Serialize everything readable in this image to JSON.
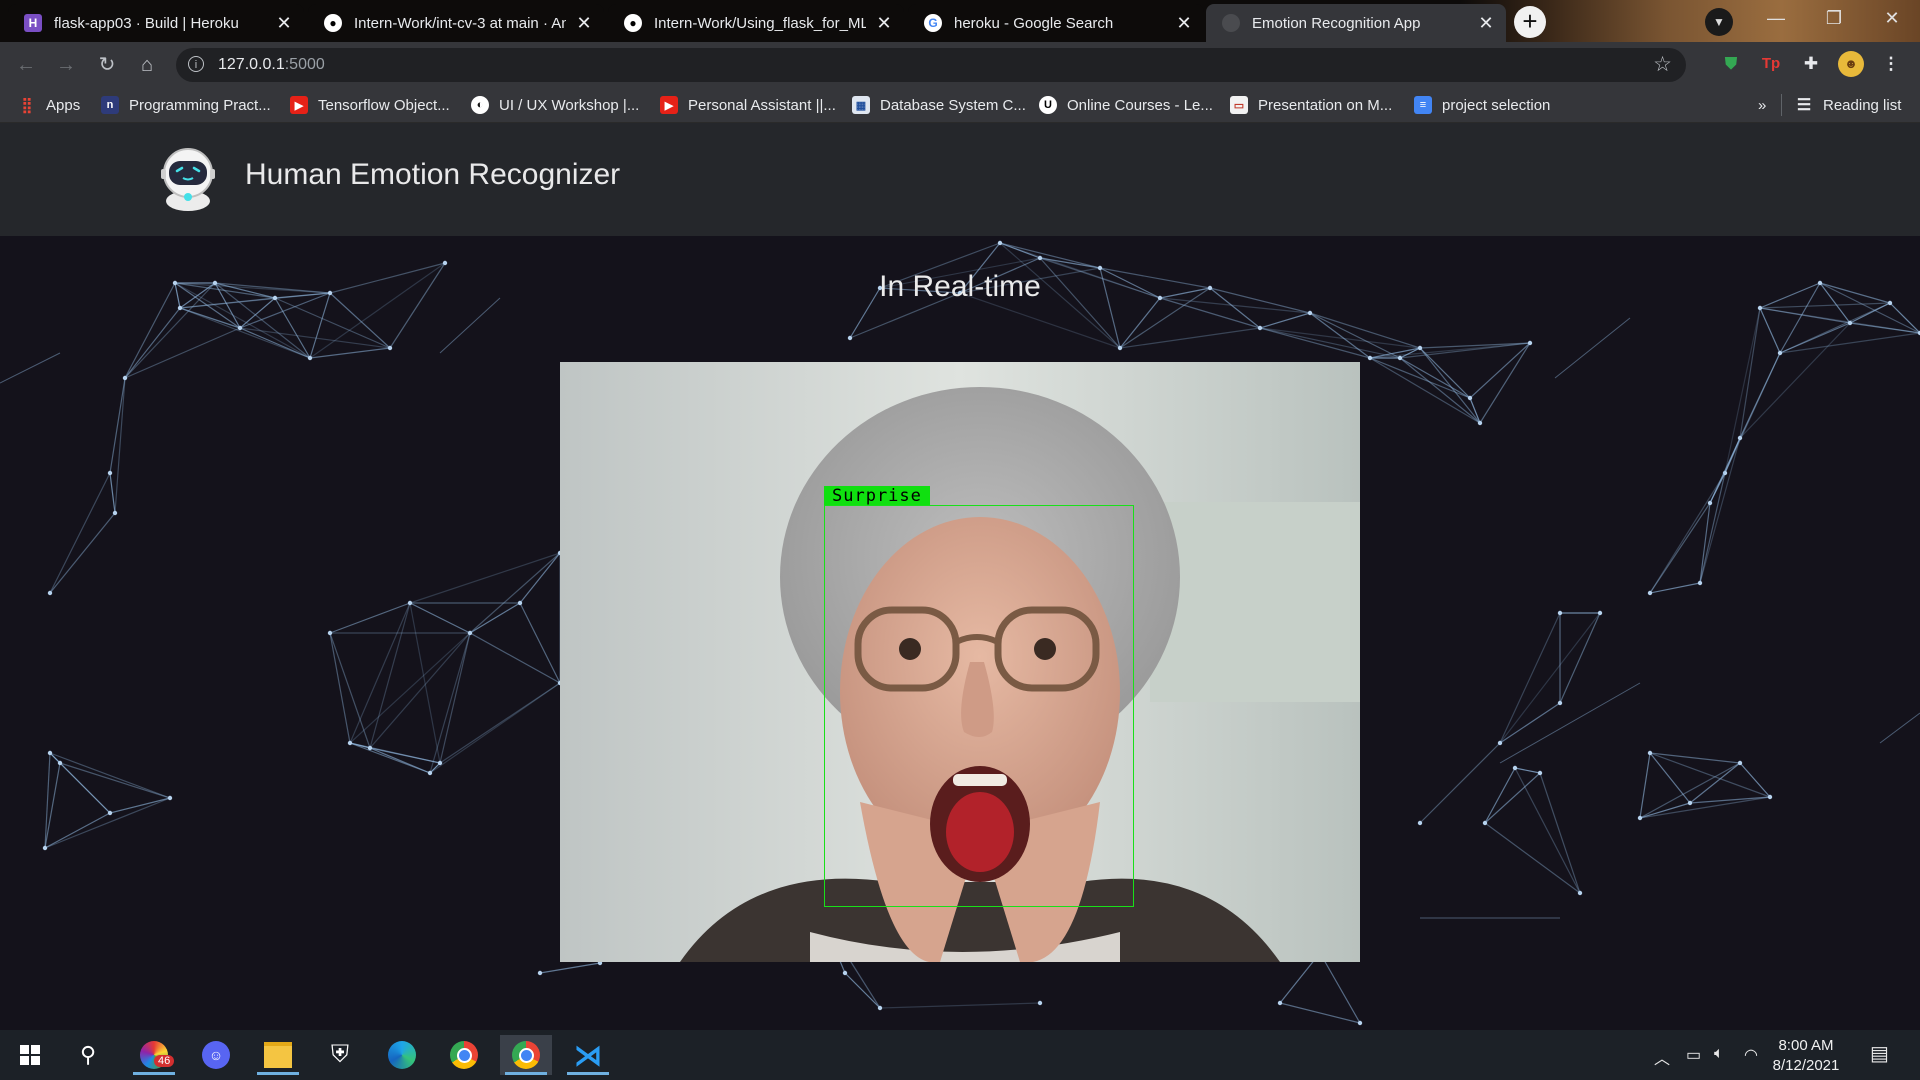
{
  "browser": {
    "tabs": [
      {
        "title": "flask-app03 · Build | Heroku",
        "favicon": "heroku-icon",
        "active": false
      },
      {
        "title": "Intern-Work/int-cv-3 at main · An",
        "favicon": "github-icon",
        "active": false
      },
      {
        "title": "Intern-Work/Using_flask_for_ML",
        "favicon": "github-icon",
        "active": false
      },
      {
        "title": "heroku - Google Search",
        "favicon": "google-icon",
        "active": false
      },
      {
        "title": "Emotion Recognition App",
        "favicon": "loading-icon",
        "active": true
      }
    ],
    "new_tab_label": "+",
    "address": {
      "host": "127.0.0.1",
      "port": ":5000"
    },
    "bookmarks": [
      {
        "label": "Apps",
        "icon": "apps-grid-icon"
      },
      {
        "label": "Programming Pract...",
        "icon": "bookmark-site-icon"
      },
      {
        "label": "Tensorflow Object...",
        "icon": "youtube-icon"
      },
      {
        "label": "UI / UX Workshop |...",
        "icon": "globe-icon"
      },
      {
        "label": "Personal Assistant ||...",
        "icon": "youtube-icon"
      },
      {
        "label": "Database System C...",
        "icon": "database-site-icon"
      },
      {
        "label": "Online Courses - Le...",
        "icon": "udemy-icon"
      },
      {
        "label": "Presentation on M...",
        "icon": "slides-icon"
      },
      {
        "label": "project selection",
        "icon": "docs-icon"
      }
    ],
    "bookmarks_overflow": "»",
    "reading_list": "Reading list"
  },
  "app": {
    "title": "Human Emotion Recognizer",
    "subtitle": "In Real-time",
    "detection_label": "Surprise"
  },
  "taskbar": {
    "apps": [
      "start-icon",
      "search-icon",
      "color-app-icon",
      "discord-icon",
      "file-explorer-icon",
      "windows-security-icon",
      "edge-icon",
      "chrome-icon",
      "chrome-active-icon",
      "vscode-icon"
    ],
    "badge": "46",
    "time": "8:00 AM",
    "date": "8/12/2021"
  },
  "colors": {
    "page_bg": "#14121b",
    "header_bg": "#25272b",
    "network_lines": "#8fb6dd",
    "detection_box": "#19e019"
  }
}
